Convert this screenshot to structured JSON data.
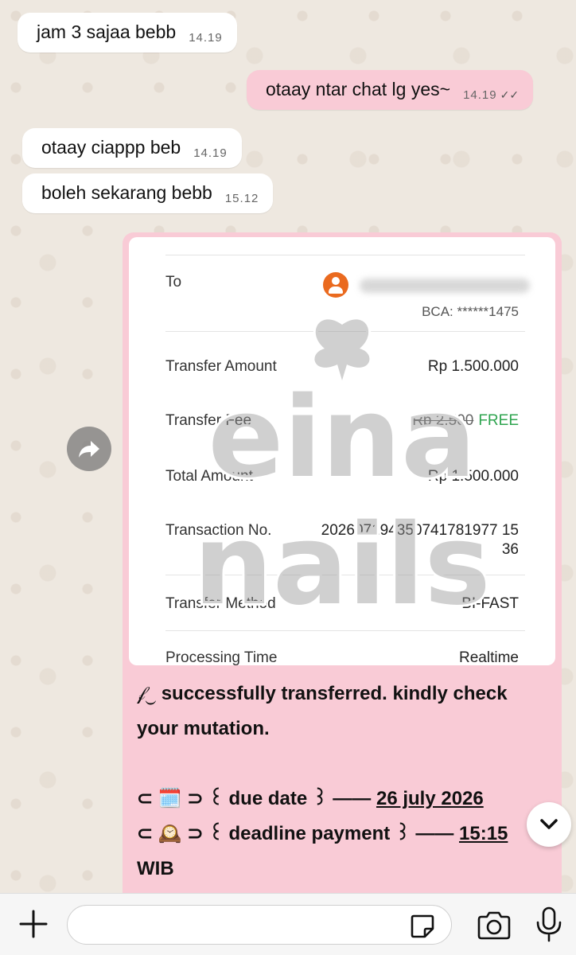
{
  "messages": [
    {
      "direction": "in",
      "text": "jam 3 sajaa bebb",
      "time": "14.19"
    },
    {
      "direction": "out",
      "text": "otaay ntar chat lg yes~",
      "time": "14.19",
      "status": "read"
    },
    {
      "direction": "in",
      "text": "otaay ciappp beb",
      "time": "14.19"
    },
    {
      "direction": "in",
      "text": "boleh sekarang bebb",
      "time": "15.12"
    }
  ],
  "receipt": {
    "to_label": "To",
    "bank_account": "BCA: ******1475",
    "transfer_amount_label": "Transfer Amount",
    "transfer_amount": "Rp 1.500.000",
    "transfer_fee_label": "Transfer Fee",
    "transfer_fee_original": "Rp 2.500",
    "transfer_fee": "FREE",
    "total_amount_label": "Total Amount",
    "total_amount": "Rp 1.500.000",
    "transaction_no_label": "Transaction No.",
    "transaction_no_line1": "202607194350741781977 15",
    "transaction_no_line2": "36",
    "transfer_method_label": "Transfer Method",
    "transfer_method": "BI-FAST",
    "processing_time_label": "Processing Time",
    "processing_time": "Realtime",
    "watermark_line1": "eina",
    "watermark_line2": "nails"
  },
  "caption": {
    "line1": "successfully transferred. kindly check your mutation.",
    "due_prefix": "⊂ 🗓️ ⊃ ꒰ due date ꒱ —— ",
    "due_value": "26 july 2026",
    "deadline_prefix": "⊂ 🕰️ ⊃ ꒰ deadline payment ꒱ —— ",
    "deadline_value": "15:15",
    "deadline_suffix": "WIB"
  },
  "composer": {
    "placeholder": ""
  },
  "colors": {
    "outgoing_bubble": "#f9cbd6",
    "incoming_bubble": "#ffffff",
    "free_text": "#2ea44f",
    "avatar": "#ea6a1f"
  },
  "icons": [
    "forward-icon",
    "chevron-down-icon",
    "plus-icon",
    "sticker-icon",
    "camera-icon",
    "microphone-icon",
    "read-ticks-icon"
  ]
}
